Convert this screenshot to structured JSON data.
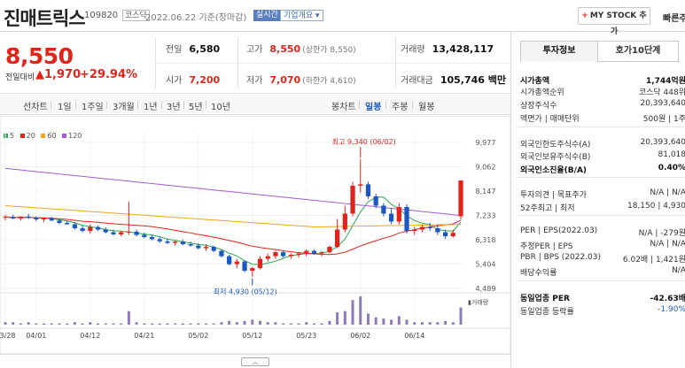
{
  "header": {
    "title": "진매트릭스",
    "code": "109820",
    "market": "코스닥",
    "date": "2022.06.22 기준(장마감)",
    "realtime_badge": "실시간",
    "overview_label": "기업개요",
    "mystock_label": "MY STOCK 추가",
    "trade_link": "빠른주"
  },
  "price": {
    "current": "8,550",
    "change_label": "전일대비",
    "change_abs": "1,970",
    "change_pct": "+29.94%",
    "prev_close_label": "전일",
    "prev_close": "6,580",
    "high_label": "고가",
    "high": "8,550",
    "upper_limit_label": "(상한가 8,550)",
    "volume_label": "거래량",
    "volume": "13,428,117",
    "open_label": "시가",
    "open": "7,200",
    "low_label": "저가",
    "low": "7,070",
    "lower_limit_label": "(하한가 4,610)",
    "amount_label": "거래대금",
    "amount": "105,746 백만"
  },
  "toolbar": {
    "left_items": [
      "선차트",
      "1일",
      "1주일",
      "3개월",
      "1년",
      "3년",
      "5년",
      "10년"
    ],
    "right_items": [
      "봉차트",
      "일봉",
      "주봉",
      "월봉"
    ],
    "active": "일봉"
  },
  "chart_data": {
    "type": "candlestick",
    "legend": [
      "5",
      "20",
      "60",
      "120"
    ],
    "legend_colors": [
      "#2ea84b",
      "#e2231a",
      "#f2a31b",
      "#a05bd4"
    ],
    "y_ticks": [
      9977,
      9062,
      8147,
      7233,
      6318,
      5404,
      4489
    ],
    "y_tick_labels": [
      "9,977",
      "9,062",
      "8,147",
      "7,233",
      "6,318",
      "5,404",
      "4,489"
    ],
    "ylim": [
      4489,
      9977
    ],
    "x_labels": [
      "03/28",
      "04/01",
      "04/12",
      "04/21",
      "05/02",
      "05/12",
      "05/23",
      "06/02",
      "06/14"
    ],
    "high_note": "최고 9,340 (06/02)",
    "low_note": "최저 4,930 (05/12)",
    "volume_label": "거래량",
    "candles": [
      {
        "d": "03/28",
        "o": 7150,
        "h": 7250,
        "l": 7050,
        "c": 7180
      },
      {
        "d": "03/29",
        "o": 7180,
        "h": 7260,
        "l": 7080,
        "c": 7120
      },
      {
        "d": "03/30",
        "o": 7120,
        "h": 7200,
        "l": 7040,
        "c": 7190
      },
      {
        "d": "03/31",
        "o": 7190,
        "h": 7290,
        "l": 7100,
        "c": 7150
      },
      {
        "d": "04/01",
        "o": 7150,
        "h": 7200,
        "l": 7010,
        "c": 7080
      },
      {
        "d": "04/04",
        "o": 7080,
        "h": 7160,
        "l": 6980,
        "c": 7130
      },
      {
        "d": "04/05",
        "o": 7130,
        "h": 7180,
        "l": 7020,
        "c": 7040
      },
      {
        "d": "04/06",
        "o": 7040,
        "h": 7100,
        "l": 6900,
        "c": 6950
      },
      {
        "d": "04/07",
        "o": 6950,
        "h": 7050,
        "l": 6880,
        "c": 6900
      },
      {
        "d": "04/08",
        "o": 6900,
        "h": 6980,
        "l": 6700,
        "c": 6750
      },
      {
        "d": "04/11",
        "o": 6750,
        "h": 6850,
        "l": 6600,
        "c": 6650
      },
      {
        "d": "04/12",
        "o": 6650,
        "h": 6900,
        "l": 6550,
        "c": 6800
      },
      {
        "d": "04/13",
        "o": 6800,
        "h": 6850,
        "l": 6650,
        "c": 6700
      },
      {
        "d": "04/14",
        "o": 6700,
        "h": 6780,
        "l": 6560,
        "c": 6600
      },
      {
        "d": "04/15",
        "o": 6600,
        "h": 6700,
        "l": 6480,
        "c": 6520
      },
      {
        "d": "04/18",
        "o": 6520,
        "h": 6650,
        "l": 6450,
        "c": 6600
      },
      {
        "d": "04/19",
        "o": 6600,
        "h": 7750,
        "l": 6500,
        "c": 6620
      },
      {
        "d": "04/20",
        "o": 6620,
        "h": 6700,
        "l": 6450,
        "c": 6500
      },
      {
        "d": "04/21",
        "o": 6500,
        "h": 6580,
        "l": 6380,
        "c": 6420
      },
      {
        "d": "04/22",
        "o": 6420,
        "h": 6500,
        "l": 6300,
        "c": 6340
      },
      {
        "d": "04/25",
        "o": 6340,
        "h": 6420,
        "l": 6200,
        "c": 6260
      },
      {
        "d": "04/26",
        "o": 6260,
        "h": 6350,
        "l": 6150,
        "c": 6200
      },
      {
        "d": "04/27",
        "o": 6200,
        "h": 6300,
        "l": 6100,
        "c": 6250
      },
      {
        "d": "04/28",
        "o": 6250,
        "h": 6320,
        "l": 6120,
        "c": 6150
      },
      {
        "d": "04/29",
        "o": 6150,
        "h": 6250,
        "l": 6050,
        "c": 6100
      },
      {
        "d": "05/02",
        "o": 6100,
        "h": 6180,
        "l": 5950,
        "c": 6000
      },
      {
        "d": "05/03",
        "o": 6000,
        "h": 6150,
        "l": 5900,
        "c": 6050
      },
      {
        "d": "05/04",
        "o": 6050,
        "h": 6100,
        "l": 5850,
        "c": 5900
      },
      {
        "d": "05/06",
        "o": 5900,
        "h": 5950,
        "l": 5650,
        "c": 5700
      },
      {
        "d": "05/09",
        "o": 5700,
        "h": 5750,
        "l": 5350,
        "c": 5400
      },
      {
        "d": "05/10",
        "o": 5400,
        "h": 5600,
        "l": 5250,
        "c": 5500
      },
      {
        "d": "05/11",
        "o": 5500,
        "h": 5550,
        "l": 5100,
        "c": 5150
      },
      {
        "d": "05/12",
        "o": 5150,
        "h": 5300,
        "l": 4930,
        "c": 5250
      },
      {
        "d": "05/13",
        "o": 5250,
        "h": 5700,
        "l": 5200,
        "c": 5600
      },
      {
        "d": "05/16",
        "o": 5600,
        "h": 5800,
        "l": 5500,
        "c": 5700
      },
      {
        "d": "05/17",
        "o": 5700,
        "h": 5900,
        "l": 5600,
        "c": 5850
      },
      {
        "d": "05/18",
        "o": 5850,
        "h": 5900,
        "l": 5650,
        "c": 5700
      },
      {
        "d": "05/19",
        "o": 5700,
        "h": 5800,
        "l": 5600,
        "c": 5750
      },
      {
        "d": "05/20",
        "o": 5750,
        "h": 5850,
        "l": 5650,
        "c": 5800
      },
      {
        "d": "05/23",
        "o": 5800,
        "h": 5950,
        "l": 5700,
        "c": 5900
      },
      {
        "d": "05/24",
        "o": 5900,
        "h": 5950,
        "l": 5750,
        "c": 5800
      },
      {
        "d": "05/25",
        "o": 5800,
        "h": 5900,
        "l": 5700,
        "c": 5850
      },
      {
        "d": "05/26",
        "o": 5850,
        "h": 6100,
        "l": 5800,
        "c": 6050
      },
      {
        "d": "05/27",
        "o": 6050,
        "h": 7100,
        "l": 6000,
        "c": 6700
      },
      {
        "d": "05/30",
        "o": 6700,
        "h": 7600,
        "l": 6600,
        "c": 7300
      },
      {
        "d": "05/31",
        "o": 7300,
        "h": 8500,
        "l": 7200,
        "c": 8350
      },
      {
        "d": "06/02",
        "o": 8350,
        "h": 9340,
        "l": 8100,
        "c": 8400
      },
      {
        "d": "06/03",
        "o": 8400,
        "h": 8500,
        "l": 7850,
        "c": 7950
      },
      {
        "d": "06/07",
        "o": 7950,
        "h": 8050,
        "l": 7500,
        "c": 7600
      },
      {
        "d": "06/08",
        "o": 7600,
        "h": 7700,
        "l": 7200,
        "c": 7300
      },
      {
        "d": "06/09",
        "o": 7300,
        "h": 7500,
        "l": 6900,
        "c": 7000
      },
      {
        "d": "06/10",
        "o": 7000,
        "h": 7700,
        "l": 6900,
        "c": 7550
      },
      {
        "d": "06/13",
        "o": 7550,
        "h": 7650,
        "l": 6550,
        "c": 6650
      },
      {
        "d": "06/14",
        "o": 6650,
        "h": 6800,
        "l": 6500,
        "c": 6700
      },
      {
        "d": "06/15",
        "o": 6700,
        "h": 6900,
        "l": 6600,
        "c": 6800
      },
      {
        "d": "06/16",
        "o": 6800,
        "h": 6950,
        "l": 6650,
        "c": 6750
      },
      {
        "d": "06/17",
        "o": 6750,
        "h": 6900,
        "l": 6500,
        "c": 6600
      },
      {
        "d": "06/20",
        "o": 6600,
        "h": 6700,
        "l": 6350,
        "c": 6450
      },
      {
        "d": "06/21",
        "o": 6450,
        "h": 6700,
        "l": 6400,
        "c": 6580
      },
      {
        "d": "06/22",
        "o": 7200,
        "h": 8550,
        "l": 7070,
        "c": 8550
      }
    ],
    "volumes": [
      2,
      2,
      1,
      2,
      1,
      1,
      1,
      1,
      1,
      2,
      1,
      2,
      1,
      1,
      1,
      1,
      11,
      2,
      1,
      1,
      1,
      1,
      1,
      1,
      1,
      1,
      1,
      1,
      2,
      3,
      2,
      3,
      4,
      3,
      2,
      2,
      1,
      1,
      1,
      2,
      1,
      1,
      3,
      10,
      11,
      20,
      23,
      9,
      6,
      5,
      4,
      7,
      4,
      2,
      2,
      2,
      2,
      3,
      2,
      14
    ],
    "ma5_end": 7100,
    "ma20_end": 7000,
    "ma60_end": 6900,
    "ma120_end": 7300
  },
  "side": {
    "tabs": [
      "투자정보",
      "호가10단계"
    ],
    "rows": [
      {
        "label": "시가총액",
        "value": "1,744억원",
        "bold": true
      },
      {
        "label": "시가총액순위",
        "value": "코스닥 448위"
      },
      {
        "label": "상장주식수",
        "value": "20,393,640"
      },
      {
        "label": "액면가 | 매매단위",
        "value": "500원 | 1주"
      },
      {
        "label": "외국인한도주식수(A)",
        "value": "20,393,640"
      },
      {
        "label": "외국인보유주식수(B)",
        "value": "81,018"
      },
      {
        "label": "외국인소진율(B/A)",
        "value": "0.40%",
        "bold": true
      },
      {
        "label": "투자의견 | 목표주가",
        "value": "N/A | N/A"
      },
      {
        "label": "52주최고 | 최저",
        "value": "18,150 | 4,930"
      },
      {
        "label": "PER | EPS(2022.03)",
        "value": "N/A | -279원"
      },
      {
        "label": "추정PER | EPS",
        "value": "N/A | N/A"
      },
      {
        "label": "PBR | BPS (2022.03)",
        "value": "6.02배 | 1,421원"
      },
      {
        "label": "배당수익률",
        "value": "N/A"
      },
      {
        "label": "동일업종 PER",
        "value": "-42.63배",
        "bold": true
      },
      {
        "label": "동일업종 등락률",
        "value": "-1.90%",
        "blue": true
      }
    ]
  },
  "colors": {
    "up": "#e2231a",
    "down": "#1d58c2",
    "accent": "#2260c8"
  }
}
